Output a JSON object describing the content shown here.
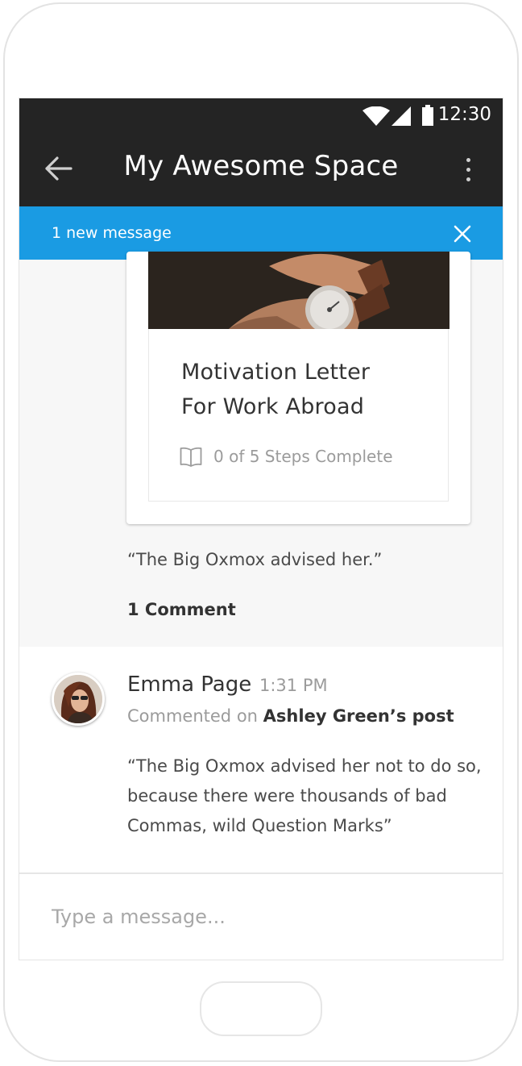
{
  "status_bar": {
    "time": "12:30"
  },
  "app_bar": {
    "title": "My Awesome Space"
  },
  "banner": {
    "text": "1 new message"
  },
  "course_card": {
    "title_line1": "Motivation Letter",
    "title_line2": "For Work Abroad",
    "steps_text": "0 of 5 Steps Complete"
  },
  "post": {
    "quote": "“The Big Oxmox advised her.”",
    "comment_count": "1 Comment"
  },
  "comment": {
    "author": "Emma Page",
    "time": "1:31 PM",
    "action": "Commented on",
    "target": "Ashley Green’s post",
    "body": "“The Big Oxmox advised her not to do so, because there were thousands of bad Commas, wild Question Marks”"
  },
  "composer": {
    "placeholder": "Type a message..."
  },
  "colors": {
    "app_bar": "#242424",
    "banner": "#1a9be3",
    "background": "#f7f7f7"
  }
}
